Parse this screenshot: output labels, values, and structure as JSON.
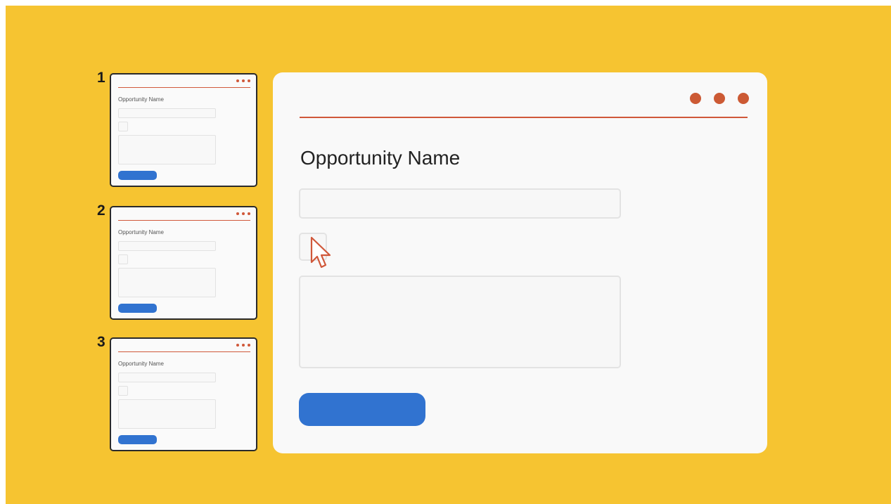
{
  "colors": {
    "background": "#f6c431",
    "window": "#f9f9f9",
    "accent_orange": "#cc5a34",
    "button_blue": "#3173d0"
  },
  "thumbnails": [
    {
      "number": "1",
      "title": "Opportunity Name"
    },
    {
      "number": "2",
      "title": "Opportunity Name"
    },
    {
      "number": "3",
      "title": "Opportunity Name"
    }
  ],
  "main": {
    "title": "Opportunity Name",
    "name_input_value": "",
    "description_value": "",
    "checkbox_checked": false
  },
  "icons": {
    "window_menu": "dots-icon",
    "pointer": "cursor-icon"
  }
}
